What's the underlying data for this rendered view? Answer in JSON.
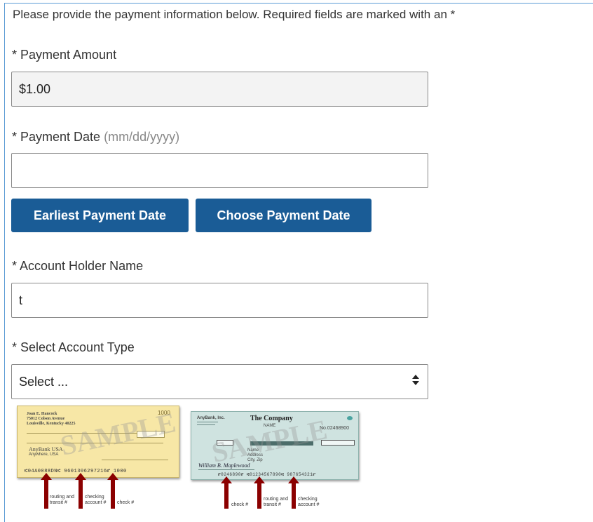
{
  "intro": "Please provide the payment information below. Required fields are marked with an *",
  "payment_amount": {
    "label": "* Payment Amount",
    "value": "$1.00"
  },
  "payment_date": {
    "label": "* Payment Date",
    "hint": "(mm/dd/yyyy)",
    "value": ""
  },
  "buttons": {
    "earliest": "Earliest Payment Date",
    "choose": "Choose Payment Date"
  },
  "account_holder": {
    "label": "* Account Holder Name",
    "value": "t"
  },
  "account_type": {
    "label": "* Select Account Type",
    "selected": "Select ..."
  },
  "check1": {
    "name_line1": "Joan E. Hancock",
    "name_line2": "75012 Colson Avenue",
    "name_line3": "Louisville, Kentucky 40225",
    "check_no": "1000",
    "bank": "AnyBank USA",
    "bank_city": "Anywhere, USA",
    "micr": "⑆04A0088DN⑆  9601306297216⑈  1000",
    "watermark": "SAMPLE",
    "labels": {
      "routing": "routing and\ntransit #",
      "checking": "checking\naccount #",
      "check": "check #"
    }
  },
  "check2": {
    "bank": "AnyBank, Inc.",
    "company": "The Company",
    "company_sub": "NAME",
    "check_no": "No.02468900",
    "payee": "Name\nAddress\nCity, Zip",
    "signature": "William B. Maplewood",
    "micr": "⑈0246890⑈   ⑆01234567890⑆   987654321⑈",
    "watermark": "SAMPLE",
    "labels": {
      "check": "check #",
      "routing": "routing and\ntransit #",
      "checking": "checking\naccount #"
    }
  },
  "colors": {
    "button": "#1a5c96",
    "frame": "#5b9bd5",
    "check1_bg": "#f7e7a6",
    "check2_bg": "#cfe3e0",
    "arrow": "#8b0000"
  }
}
